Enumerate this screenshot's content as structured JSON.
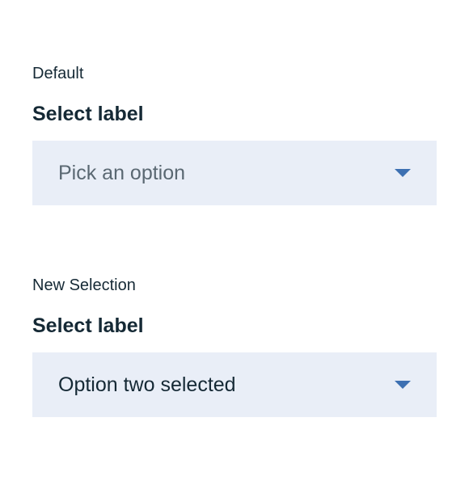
{
  "default_section": {
    "caption": "Default",
    "label": "Select label",
    "placeholder": "Pick an option"
  },
  "new_selection_section": {
    "caption": "New Selection",
    "label": "Select label",
    "selected_value": "Option two selected"
  },
  "colors": {
    "field_background": "#e9eef7",
    "caret": "#3d70b2",
    "text": "#152935",
    "placeholder_text": "#5a6872"
  },
  "icons": {
    "dropdown": "caret-down-icon"
  }
}
